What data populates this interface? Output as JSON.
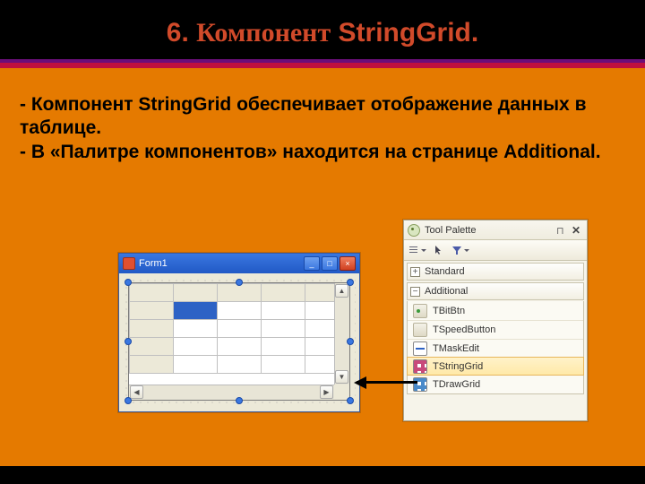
{
  "title": {
    "num": "6.",
    "comp": "Компонент",
    "sg": "StringGrid."
  },
  "body": {
    "p1": "- Компонент StringGrid обеспечивает отображение данных в таблице.",
    "p2": " - В «Палитре компонентов» находится на странице Additional."
  },
  "form": {
    "title": "Form1",
    "min": "_",
    "max": "□",
    "close": "×"
  },
  "palette": {
    "title": "Tool Palette",
    "pin": "⊓",
    "close": "✕",
    "cat_standard": "Standard",
    "cat_additional": "Additional",
    "plus": "+",
    "minus": "−",
    "items": {
      "bitbtn": "TBitBtn",
      "speed": "TSpeedButton",
      "mask": "TMaskEdit",
      "sgrid": "TStringGrid",
      "dgrid": "TDrawGrid"
    }
  },
  "scroll": {
    "up": "▲",
    "down": "▼",
    "left": "◀",
    "right": "▶"
  }
}
